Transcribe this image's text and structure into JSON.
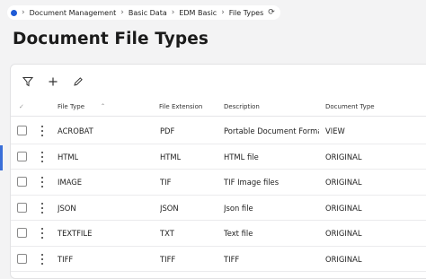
{
  "breadcrumb": {
    "items": [
      "Document Management",
      "Basic Data",
      "EDM Basic",
      "File Types"
    ]
  },
  "page": {
    "title": "Document File Types"
  },
  "toolbar": {
    "icons": [
      "filter-icon",
      "plus-icon",
      "pencil-icon"
    ]
  },
  "table": {
    "columns": [
      "File Type",
      "File Extension",
      "Description",
      "Document Type"
    ],
    "rows": [
      {
        "file_type": "ACROBAT",
        "extension": "PDF",
        "description": "Portable Document Forma",
        "doc_type": "VIEW"
      },
      {
        "file_type": "HTML",
        "extension": "HTML",
        "description": "HTML file",
        "doc_type": "ORIGINAL"
      },
      {
        "file_type": "IMAGE",
        "extension": "TIF",
        "description": "TIF Image files",
        "doc_type": "ORIGINAL"
      },
      {
        "file_type": "JSON",
        "extension": "JSON",
        "description": "Json file",
        "doc_type": "ORIGINAL"
      },
      {
        "file_type": "TEXTFILE",
        "extension": "TXT",
        "description": "Text file",
        "doc_type": "ORIGINAL"
      },
      {
        "file_type": "TIFF",
        "extension": "TIFF",
        "description": "TIFF",
        "doc_type": "ORIGINAL"
      }
    ]
  },
  "colors": {
    "accent": "#1f5bd6"
  }
}
